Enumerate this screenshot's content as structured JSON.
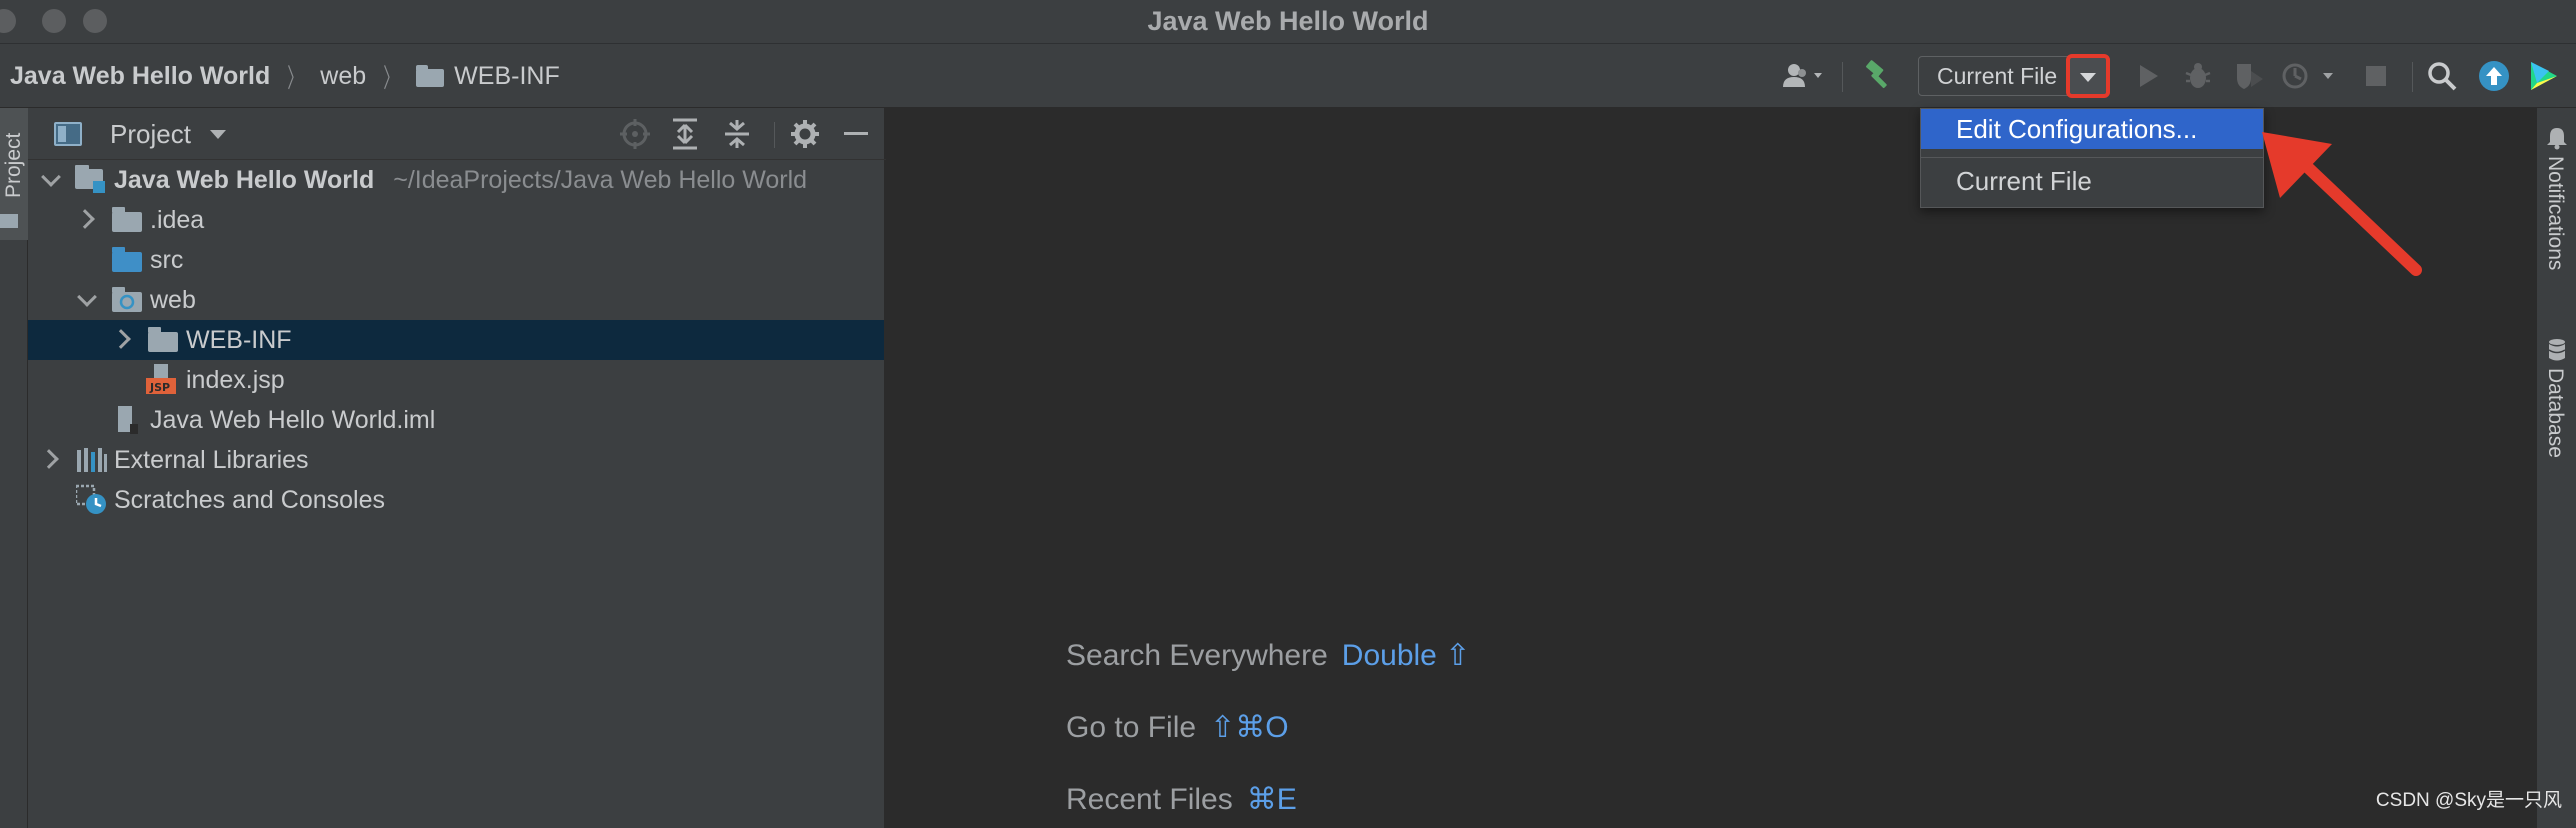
{
  "window": {
    "title": "Java Web Hello World"
  },
  "breadcrumb": {
    "project": "Java Web Hello World",
    "folder1": "web",
    "folder2": "WEB-INF"
  },
  "toolbar": {
    "run_config_label": "Current File"
  },
  "popup": {
    "items": [
      {
        "label": "Edit Configurations..."
      },
      {
        "label": "Current File"
      }
    ]
  },
  "left_stripe": {
    "tab_label": "Project"
  },
  "project_panel": {
    "title": "Project",
    "tree": [
      {
        "label": "Java Web Hello World",
        "hint": "~/IdeaProjects/Java Web Hello World"
      },
      {
        "label": ".idea"
      },
      {
        "label": "src"
      },
      {
        "label": "web"
      },
      {
        "label": "WEB-INF"
      },
      {
        "label": "index.jsp"
      },
      {
        "label": "Java Web Hello World.iml"
      },
      {
        "label": "External Libraries"
      },
      {
        "label": "Scratches and Consoles"
      }
    ]
  },
  "editor": {
    "hints": [
      {
        "text": "Search Everywhere",
        "key": "Double ⇧"
      },
      {
        "text": "Go to File",
        "key": "⇧⌘O"
      },
      {
        "text": "Recent Files",
        "key": "⌘E"
      }
    ]
  },
  "right_stripe": {
    "tabs": [
      "Notifications",
      "Database"
    ]
  },
  "watermark": "CSDN @Sky是一只风",
  "colors": {
    "accent_blue": "#2f65ca",
    "highlight_red": "#e53a2b",
    "selection": "#0d293e",
    "shortcut_blue": "#5c9fe8"
  }
}
